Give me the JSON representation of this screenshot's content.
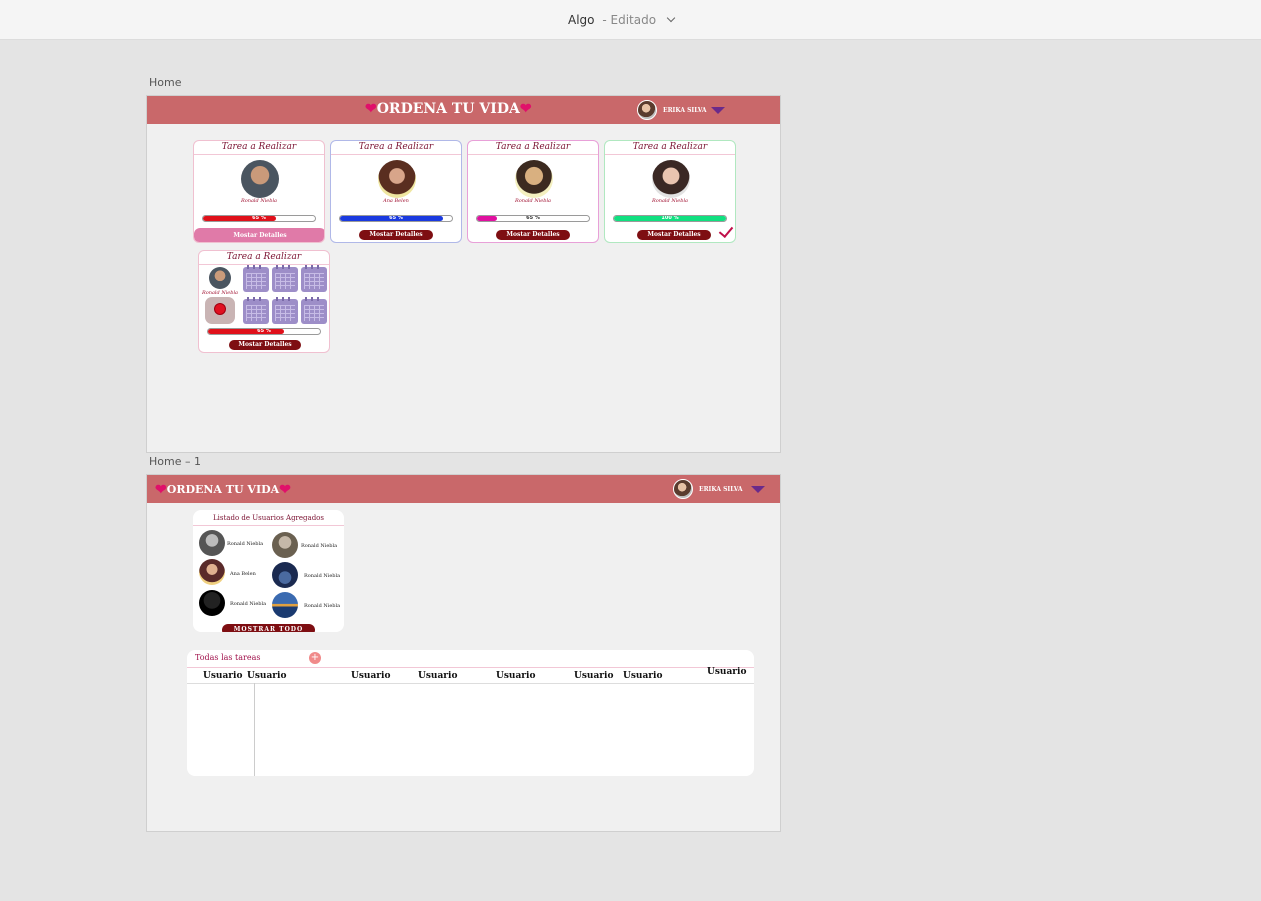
{
  "window": {
    "doc_title": "Algo",
    "doc_status": "- Editado"
  },
  "artboards": [
    {
      "label": "Home"
    },
    {
      "label": "Home – 1"
    }
  ],
  "header": {
    "brand": "ORDENA TU VIDA",
    "user_name": "ERIKA SILVA"
  },
  "task_cards": [
    {
      "title": "Tarea a Realizar",
      "assignee": "Ronald Niebla",
      "progress": 65,
      "progress_label": "65 %",
      "bar_color": "#e0101a",
      "button": "Mostar Detalles"
    },
    {
      "title": "Tarea a Realizar",
      "assignee": "Ana Belen",
      "progress": 92,
      "progress_label": "65 %",
      "bar_color": "#1a3ae0",
      "button": "Mostar Detalles"
    },
    {
      "title": "Tarea a Realizar",
      "assignee": "Ronald Niebla",
      "progress": 18,
      "progress_label": "65 %",
      "bar_color": "#e010a0",
      "button": "Mostar Detalles"
    },
    {
      "title": "Tarea a Realizar",
      "assignee": "Ronald Niebla",
      "progress": 100,
      "progress_label": "100 %",
      "bar_color": "#10e080",
      "button": "Mostar Detalles",
      "completed": true
    }
  ],
  "task_card_calendar": {
    "title": "Tarea a Realizar",
    "assignee": "Ronald Niebla",
    "progress": 68,
    "progress_label": "65 %",
    "bar_color": "#e0101a",
    "button": "Mostar Detalles"
  },
  "users_panel": {
    "title": "Listado de Usuarios Agregados",
    "users": [
      {
        "name": "Ronald Niebla"
      },
      {
        "name": "Ronald Niebla"
      },
      {
        "name": "Ana Belen"
      },
      {
        "name": "Ronald Niebla"
      },
      {
        "name": "Ronald Niebla"
      },
      {
        "name": "Ronald Niebla"
      }
    ],
    "button": "MOSTRAR TODO"
  },
  "tasks_table": {
    "title": "Todas las tareas",
    "add_label": "+",
    "columns": [
      "Usuario",
      "Usuario",
      "Usuario",
      "Usuario",
      "Usuario",
      "Usuario",
      "Usuario",
      "Usuario"
    ]
  },
  "colors": {
    "header": "#c9686a",
    "accent": "#7e0e12",
    "pink": "#e0106a"
  }
}
